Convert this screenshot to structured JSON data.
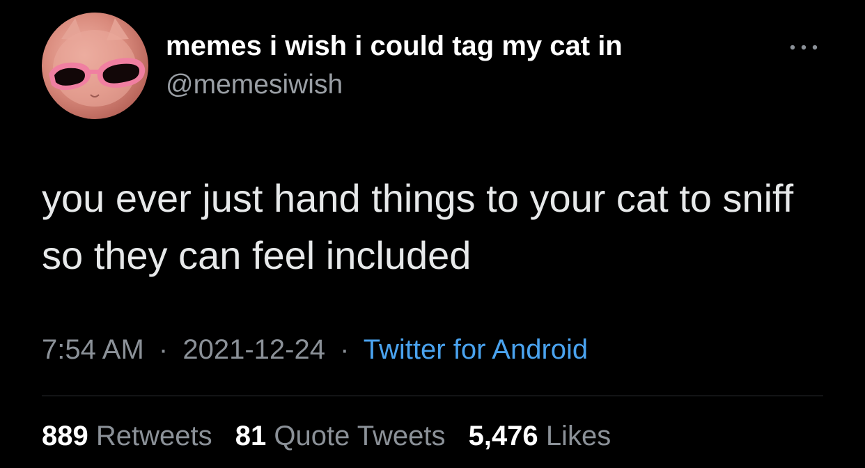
{
  "author": {
    "display_name": "memes i wish i could tag my cat in",
    "handle": "@memesiwish",
    "avatar_icon": "cat-with-pink-sunglasses-avatar"
  },
  "menu_icon": "more-options-icon",
  "tweet": {
    "text": "you ever just hand things to your cat to sniff so they can feel included"
  },
  "meta": {
    "time": "7:54 AM",
    "separator": "·",
    "date": "2021-12-24",
    "source": "Twitter for Android"
  },
  "stats": {
    "retweets_count": "889",
    "retweets_label": "Retweets",
    "quote_count": "81",
    "quote_label": "Quote Tweets",
    "likes_count": "5,476",
    "likes_label": "Likes"
  },
  "colors": {
    "background": "#000000",
    "primary_text": "#e7e9ea",
    "secondary_text": "#8b9198",
    "link": "#4aa3ef",
    "divider": "#2f3336"
  }
}
